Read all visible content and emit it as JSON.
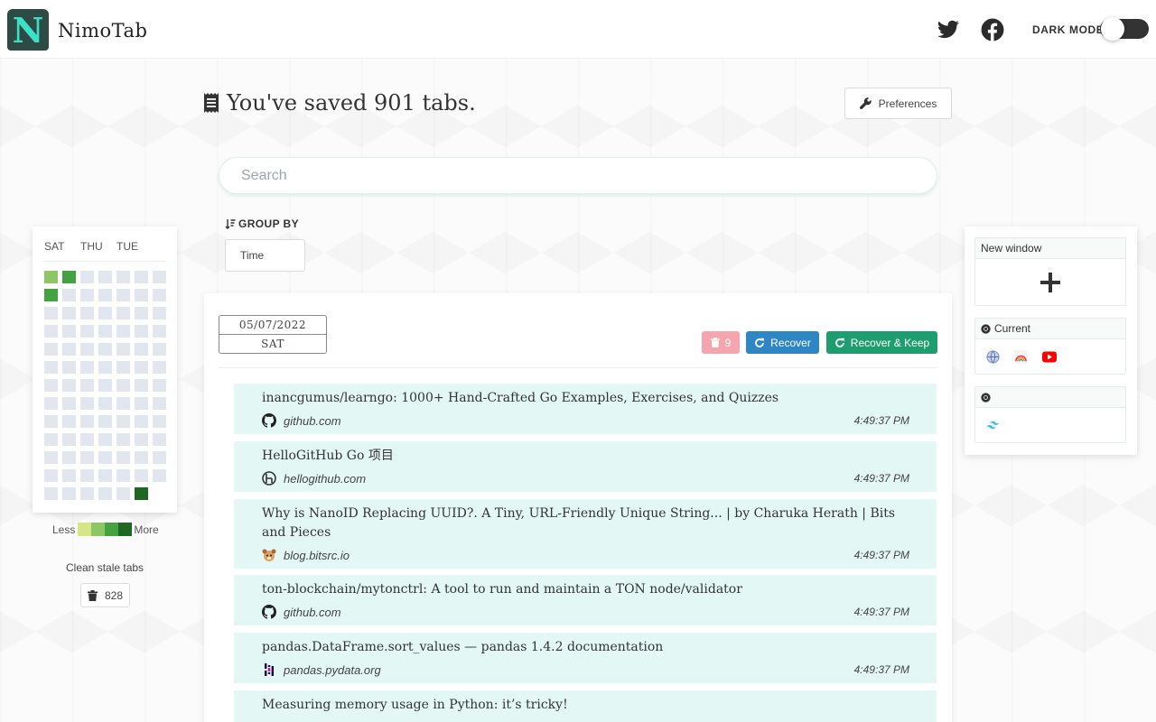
{
  "app": {
    "name": "NimoTab",
    "logo_letter": "N",
    "dark_mode_label": "DARK MODE",
    "dark_mode_on": false
  },
  "header": {
    "icons": [
      "twitter-icon",
      "facebook-icon"
    ]
  },
  "summary": {
    "title": "You've saved 901 tabs.",
    "preferences_label": "Preferences"
  },
  "search": {
    "placeholder": "Search",
    "value": ""
  },
  "group_by": {
    "label": "GROUP BY",
    "selected": "Time"
  },
  "calendar": {
    "day_labels": [
      "SAT",
      "THU",
      "TUE"
    ],
    "legend_less": "Less",
    "legend_more": "More",
    "legend_colors": [
      "#d6e685",
      "#8cc665",
      "#44a340",
      "#1e6823"
    ],
    "empty_color": "#e2e7ef",
    "columns": 7,
    "rows": 13,
    "active_cells": [
      {
        "col": 0,
        "row": 0,
        "color": "#8cc665"
      },
      {
        "col": 1,
        "row": 0,
        "color": "#44a340"
      },
      {
        "col": 0,
        "row": 1,
        "color": "#44a340"
      },
      {
        "col": 5,
        "row": 12,
        "color": "#1e6823"
      }
    ],
    "last_row_cells": 6,
    "clean_label": "Clean stale tabs",
    "clean_count": "828"
  },
  "group": {
    "date": "05/07/2022",
    "weekday": "SAT",
    "count": "9",
    "recover_label": "Recover",
    "recover_keep_label": "Recover & Keep",
    "tabs": [
      {
        "title": "inancgumus/learngo: 1000+ Hand-Crafted Go Examples, Exercises, and Quizzes",
        "domain": "github.com",
        "time": "4:49:37 PM",
        "icon": "github-icon"
      },
      {
        "title": "HelloGitHub Go 项目",
        "domain": "hellogithub.com",
        "time": "4:49:37 PM",
        "icon": "hellogithub-icon"
      },
      {
        "title": "Why is NanoID Replacing UUID?. A Tiny, URL-Friendly Unique String... | by Charuka Herath | Bits and Pieces",
        "domain": "blog.bitsrc.io",
        "time": "4:49:37 PM",
        "icon": "bitsrc-icon"
      },
      {
        "title": "ton-blockchain/mytonctrl: A tool to run and maintain a TON node/validator",
        "domain": "github.com",
        "time": "4:49:37 PM",
        "icon": "github-icon"
      },
      {
        "title": "pandas.DataFrame.sort_values — pandas 1.4.2 documentation",
        "domain": "pandas.pydata.org",
        "time": "4:49:37 PM",
        "icon": "pandas-icon"
      },
      {
        "title": "Measuring memory usage in Python: it’s tricky!",
        "domain": "",
        "time": "",
        "icon": ""
      }
    ]
  },
  "windows": {
    "new_window_label": "New window",
    "items": [
      {
        "label": "Current",
        "icon": "chrome-icon",
        "tabs": [
          "globe-icon",
          "rainbow-icon",
          "youtube-icon"
        ]
      },
      {
        "label": "",
        "icon": "chrome-icon",
        "tabs": [
          "tailwind-icon"
        ]
      }
    ]
  }
}
